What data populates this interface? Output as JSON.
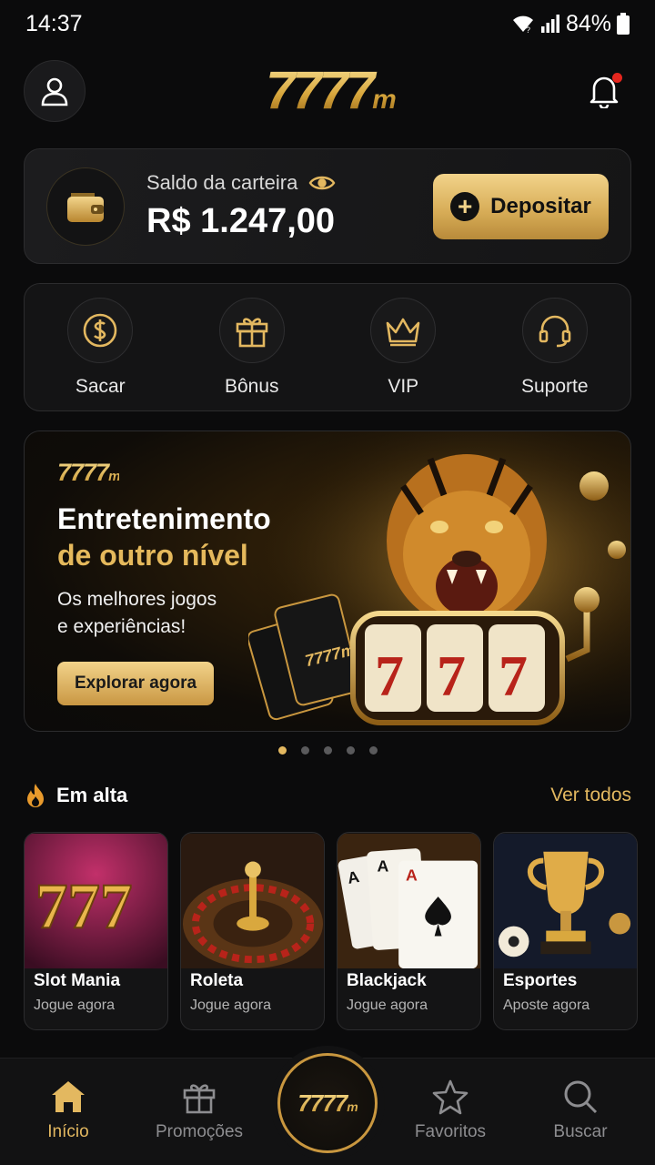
{
  "status_bar": {
    "time": "14:37",
    "battery": "84%"
  },
  "header": {
    "logo_main": "7777",
    "logo_suffix": "m"
  },
  "wallet": {
    "label": "Saldo da carteira",
    "balance": "R$ 1.247,00",
    "deposit_label": "Depositar"
  },
  "quick_actions": [
    {
      "label": "Sacar",
      "icon": "dollar-coin-icon"
    },
    {
      "label": "Bônus",
      "icon": "gift-icon"
    },
    {
      "label": "VIP",
      "icon": "crown-icon"
    },
    {
      "label": "Suporte",
      "icon": "headset-icon"
    }
  ],
  "banner": {
    "logo_main": "7777",
    "logo_suffix": "m",
    "title_line1": "Entretenimento",
    "title_line2": "de outro nível",
    "subtitle_line1": "Os melhores jogos",
    "subtitle_line2": "e experiências!",
    "cta": "Explorar agora",
    "slide_count": 5,
    "active_slide": 1
  },
  "trending": {
    "title": "Em alta",
    "see_all": "Ver todos",
    "games": [
      {
        "title": "Slot Mania",
        "subtitle": "Jogue agora"
      },
      {
        "title": "Roleta",
        "subtitle": "Jogue agora"
      },
      {
        "title": "Blackjack",
        "subtitle": "Jogue agora"
      },
      {
        "title": "Esportes",
        "subtitle": "Aposte agora"
      }
    ]
  },
  "bottom_nav": {
    "items": [
      {
        "label": "Início",
        "icon": "home-icon"
      },
      {
        "label": "Promoções",
        "icon": "gift-icon"
      },
      {
        "label": "Favoritos",
        "icon": "star-icon"
      },
      {
        "label": "Buscar",
        "icon": "search-icon"
      }
    ],
    "center_logo_main": "7777",
    "center_logo_suffix": "m"
  },
  "colors": {
    "accent_gold": "#e3b860",
    "background": "#0b0b0c",
    "notification": "#e5261e"
  }
}
